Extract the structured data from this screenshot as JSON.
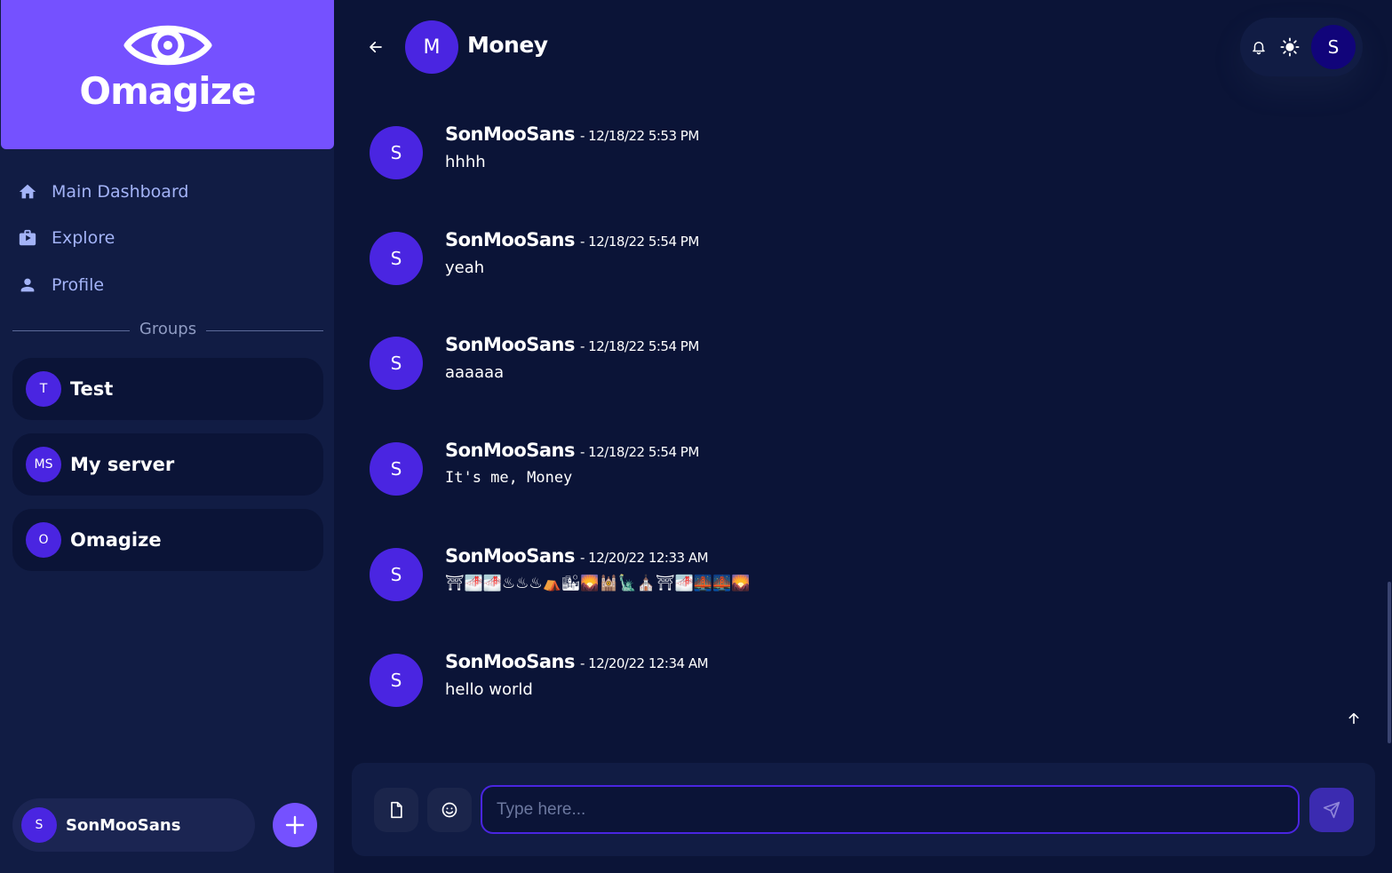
{
  "brand": {
    "name": "Omagize",
    "logo_icon": "eye-icon"
  },
  "nav": [
    {
      "label": "Main Dashboard",
      "icon": "home-icon"
    },
    {
      "label": "Explore",
      "icon": "briefcase-icon"
    },
    {
      "label": "Profile",
      "icon": "person-icon"
    }
  ],
  "groups_heading": "Groups",
  "groups": [
    {
      "initials": "T",
      "name": "Test"
    },
    {
      "initials": "MS",
      "name": "My server"
    },
    {
      "initials": "O",
      "name": "Omagize"
    }
  ],
  "current_user": {
    "initial": "S",
    "name": "SonMooSans"
  },
  "header": {
    "room_initial": "M",
    "room_name": "Money",
    "user_initial": "S"
  },
  "messages": [
    {
      "avatar": "S",
      "author": "SonMooSans",
      "time": "- 12/18/22 5:53 PM",
      "text": "hhhh",
      "mono": false
    },
    {
      "avatar": "S",
      "author": "SonMooSans",
      "time": "- 12/18/22 5:54 PM",
      "text": "yeah",
      "mono": false
    },
    {
      "avatar": "S",
      "author": "SonMooSans",
      "time": "- 12/18/22 5:54 PM",
      "text": "aaaaaa",
      "mono": false
    },
    {
      "avatar": "S",
      "author": "SonMooSans",
      "time": "- 12/18/22 5:54 PM",
      "text": "It's me, Money",
      "mono": true
    },
    {
      "avatar": "S",
      "author": "SonMooSans",
      "time": "- 12/20/22 12:33 AM",
      "text": "⛩🌁🌁♨♨♨⛺🏙🌄🕍🗽⛪⛩🌁🌉🌉🌄",
      "mono": false
    },
    {
      "avatar": "S",
      "author": "SonMooSans",
      "time": "- 12/20/22 12:34 AM",
      "text": "hello world",
      "mono": false
    }
  ],
  "composer": {
    "placeholder": "Type here..."
  },
  "colors": {
    "background": "#0b1437",
    "sidebar": "#111c44",
    "brand": "#7551ff",
    "avatar": "#4a25e1"
  }
}
